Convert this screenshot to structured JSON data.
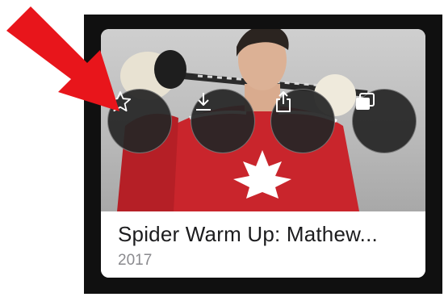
{
  "video_card": {
    "title": "Spider Warm Up: Mathew...",
    "year": "2017"
  },
  "actions": [
    {
      "icon": "star-icon"
    },
    {
      "icon": "download-icon"
    },
    {
      "icon": "share-icon"
    },
    {
      "icon": "picture-in-picture-icon"
    }
  ],
  "annotation": {
    "color": "#e8151b"
  },
  "colors": {
    "jersey": "#c9252c",
    "overlay_button": "#262626",
    "panel": "#101010"
  }
}
